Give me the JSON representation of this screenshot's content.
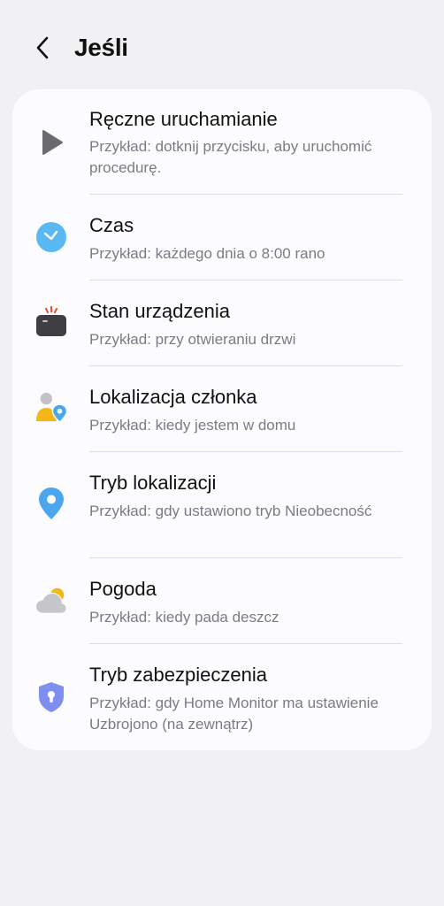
{
  "header": {
    "back_icon": "chevron-left-icon",
    "title": "Jeśli"
  },
  "items": [
    {
      "id": "manual",
      "icon": "play-icon",
      "title": "Ręczne uruchamianie",
      "desc": "Przykład: dotknij przycisku, aby uruchomić procedurę."
    },
    {
      "id": "time",
      "icon": "clock-icon",
      "title": "Czas",
      "desc": "Przykład: każdego dnia o 8:00 rano"
    },
    {
      "id": "device-state",
      "icon": "device-icon",
      "title": "Stan urządzenia",
      "desc": "Przykład: przy otwieraniu drzwi"
    },
    {
      "id": "member-location",
      "icon": "member-location-icon",
      "title": "Lokalizacja członka",
      "desc": "Przykład: kiedy jestem w domu"
    },
    {
      "id": "location-mode",
      "icon": "location-pin-icon",
      "title": "Tryb lokalizacji",
      "desc": "Przykład: gdy ustawiono tryb Nieobecność"
    },
    {
      "id": "weather",
      "icon": "weather-icon",
      "title": "Pogoda",
      "desc": "Przykład: kiedy pada deszcz"
    },
    {
      "id": "security-mode",
      "icon": "shield-icon",
      "title": "Tryb zabezpieczenia",
      "desc": "Przykład: gdy Home Monitor ma ustawienie Uzbrojono (na zewnątrz)"
    }
  ],
  "colors": {
    "background": "#f1f1f3",
    "card": "#fcfcfe",
    "play": "#6b6b6f",
    "clock": "#5ab8f2",
    "device": "#3f3f43",
    "device_signal": "#e5533f",
    "member_person_head": "#c2c2c6",
    "member_person_body": "#f5b617",
    "pin": "#4aa6ee",
    "sun": "#f5b617",
    "cloud": "#c6c6ca",
    "shield": "#7f8ff0"
  }
}
